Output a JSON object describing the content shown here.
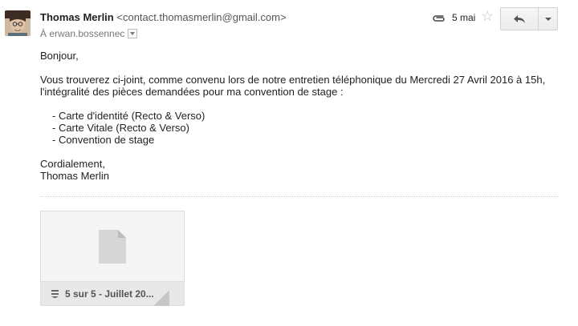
{
  "header": {
    "sender_name": "Thomas Merlin",
    "sender_email": "<contact.thomasmerlin@gmail.com>",
    "recipient": "À erwan.bossennec",
    "date": "5 mai"
  },
  "body": {
    "greeting": "Bonjour,",
    "paragraph_line1": "Vous trouverez ci-joint, comme convenu lors de notre entretien téléphonique du Mercredi 27 Avril 2016 à 15h,",
    "paragraph_line2": "l'intégralité des pièces demandées pour ma convention de stage :",
    "list": [
      "- Carte d'identité (Recto & Verso)",
      "- Carte Vitale (Recto & Verso)",
      "- Convention de stage"
    ],
    "closing": "Cordialement,",
    "signature": "Thomas Merlin"
  },
  "attachment": {
    "name": "5 sur 5 - Juillet 20..."
  },
  "icons": {
    "attachment": "paperclip-icon",
    "star": "star-icon",
    "reply": "reply-icon",
    "more": "chevron-down-icon",
    "file": "document-icon",
    "download": "download-icon"
  },
  "colors": {
    "text": "#222222",
    "muted": "#777777",
    "button_border": "#d2d2d2",
    "star": "#c6c6c6"
  }
}
